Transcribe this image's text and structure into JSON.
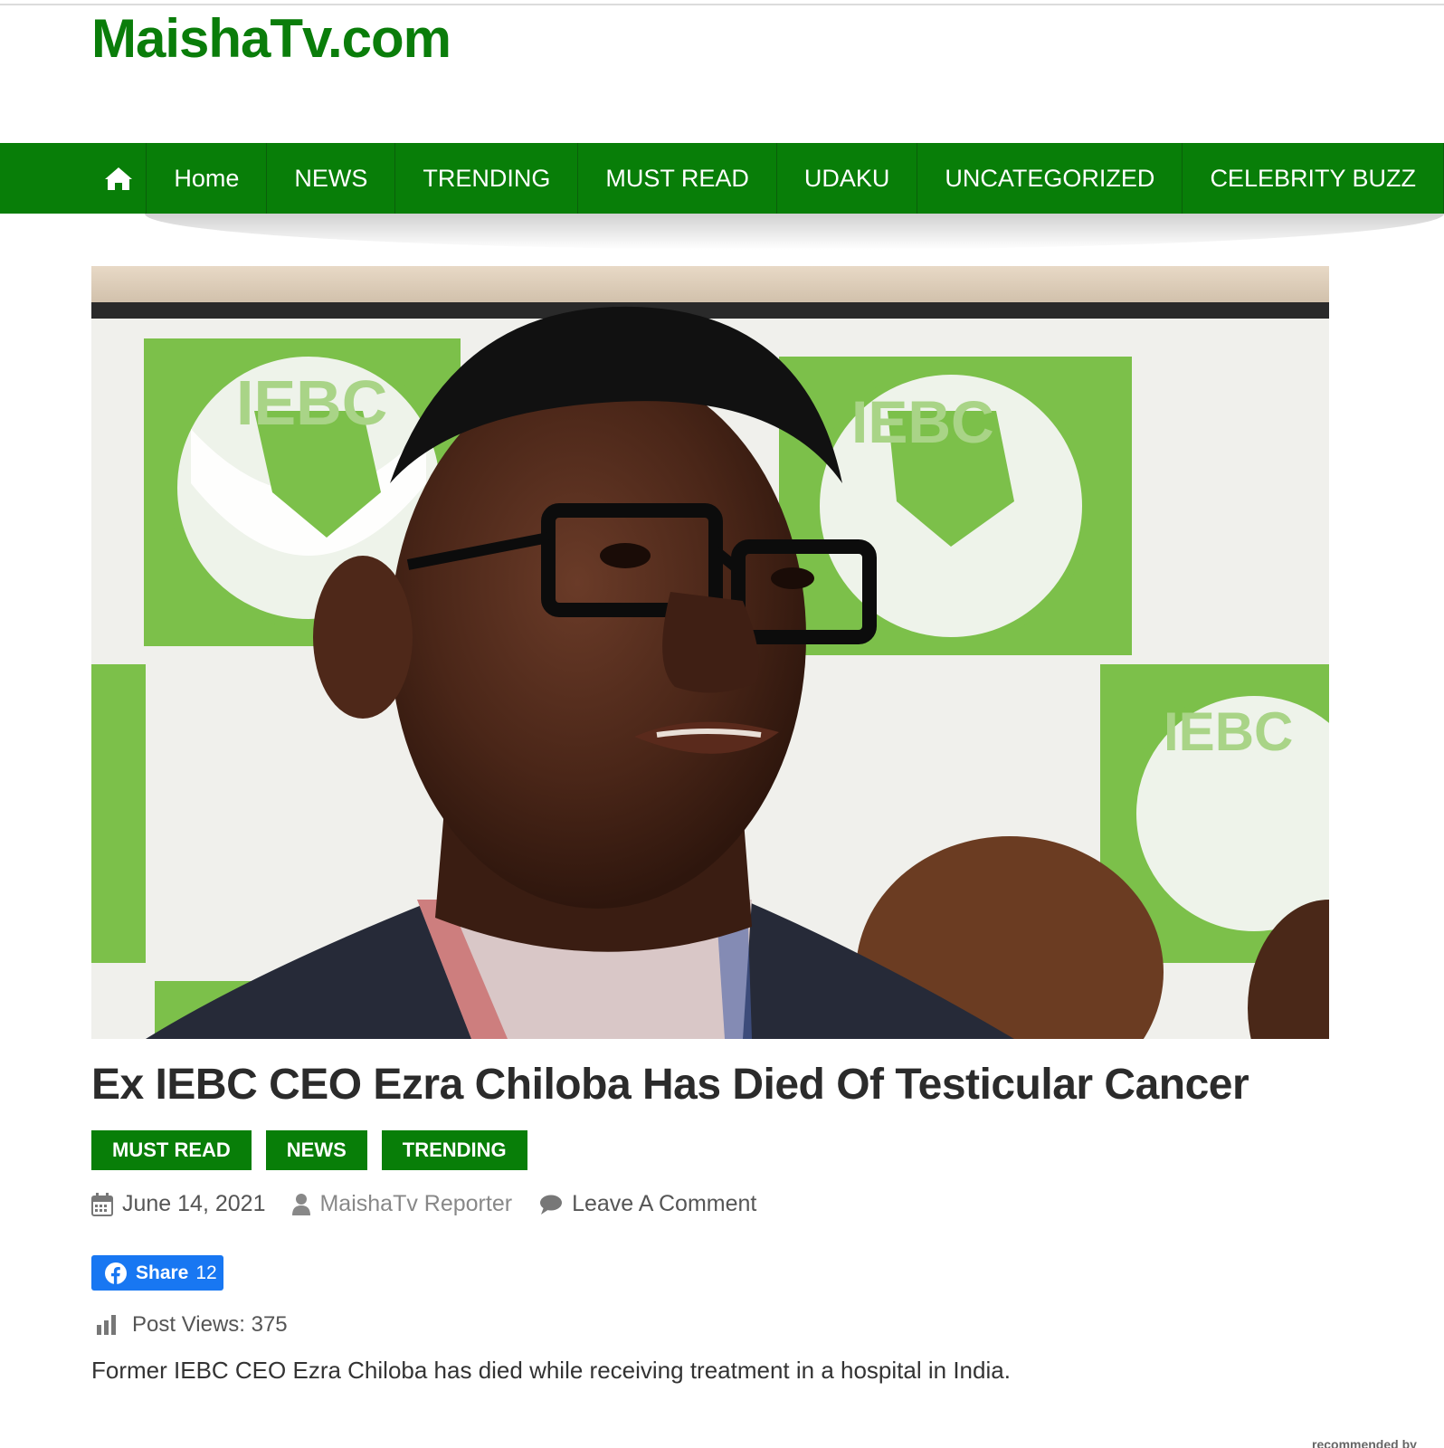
{
  "site": {
    "title": "MaishaTv.com",
    "brand_color": "#087e08"
  },
  "nav": {
    "home_icon": "home-icon",
    "items": [
      {
        "label": "Home"
      },
      {
        "label": "NEWS"
      },
      {
        "label": "TRENDING"
      },
      {
        "label": "MUST READ"
      },
      {
        "label": "UDAKU"
      },
      {
        "label": "UNCATEGORIZED"
      },
      {
        "label": "CELEBRITY BUZZ"
      }
    ]
  },
  "article": {
    "title": "Ex IEBC CEO Ezra Chiloba Has Died Of Testicular Cancer",
    "tags": [
      "MUST READ",
      "NEWS",
      "TRENDING"
    ],
    "date": "June 14, 2021",
    "author": "MaishaTv Reporter",
    "comment_link": "Leave A Comment",
    "share": {
      "label": "Share",
      "count": "12",
      "color": "#1877f2"
    },
    "post_views": "Post Views: 375",
    "body": "Former IEBC CEO Ezra Chiloba has died while receiving treatment in a hospital in India.",
    "hero_image": {
      "logo_text": "IEBC"
    }
  },
  "footer": {
    "recommended": "recommended by"
  }
}
